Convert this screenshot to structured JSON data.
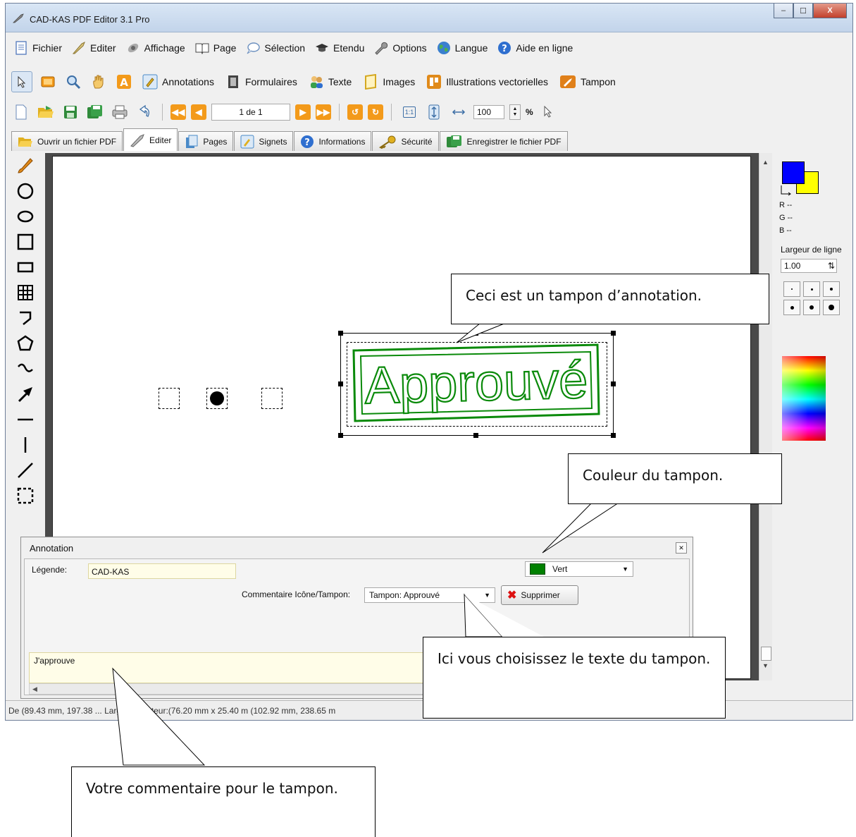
{
  "window": {
    "title": "CAD-KAS PDF Editor 3.1 Pro",
    "controls": {
      "minimize": "–",
      "maximize": "☐",
      "close": "X"
    }
  },
  "menubar": {
    "items": [
      {
        "label": "Fichier",
        "icon": "document-icon",
        "color": "#5b7fbf"
      },
      {
        "label": "Editer",
        "icon": "quill-icon",
        "color": "#b5a04a"
      },
      {
        "label": "Affichage",
        "icon": "satellite-icon",
        "color": "#8a8a8a"
      },
      {
        "label": "Page",
        "icon": "book-icon",
        "color": "#6b6b6b"
      },
      {
        "label": "Sélection",
        "icon": "speech-bubble-icon",
        "color": "#6b8fbf"
      },
      {
        "label": "Etendu",
        "icon": "graduation-cap-icon",
        "color": "#333333"
      },
      {
        "label": "Options",
        "icon": "wrench-icon",
        "color": "#8a8a8a"
      },
      {
        "label": "Langue",
        "icon": "globe-icon",
        "color": "#3a7fcf"
      },
      {
        "label": "Aide en ligne",
        "icon": "help-icon",
        "color": "#2f6fcf"
      }
    ]
  },
  "toolbar2": {
    "labels": [
      {
        "label": "Annotations",
        "icon": "annotation-pen-icon",
        "color": "#4a8ac8"
      },
      {
        "label": "Formulaires",
        "icon": "film-icon",
        "color": "#333333"
      },
      {
        "label": "Texte",
        "icon": "people-icon",
        "color": "#3aa04a"
      },
      {
        "label": "Images",
        "icon": "picture-frame-icon",
        "color": "#d4a820"
      },
      {
        "label": "Illustrations vectorielles",
        "icon": "vector-icon",
        "color": "#e08a1a"
      },
      {
        "label": "Tampon",
        "icon": "stamp-icon",
        "color": "#e0801a"
      }
    ]
  },
  "navigation": {
    "page_indicator": "1 de 1",
    "zoom_value": "100",
    "zoom_unit": "%",
    "fit_label": "1:1"
  },
  "tabs": [
    {
      "label": "Ouvrir un fichier PDF",
      "icon": "open-folder-icon",
      "color": "#e0b020",
      "active": false
    },
    {
      "label": "Editer",
      "icon": "quill-icon",
      "color": "#9a9a9a",
      "active": true
    },
    {
      "label": "Pages",
      "icon": "pages-icon",
      "color": "#4a8ac8",
      "active": false
    },
    {
      "label": "Signets",
      "icon": "bookmark-pen-icon",
      "color": "#4a8ac8",
      "active": false
    },
    {
      "label": "Informations",
      "icon": "help-icon",
      "color": "#2f6fcf",
      "active": false
    },
    {
      "label": "Sécurité",
      "icon": "key-icon",
      "color": "#c9a020",
      "active": false
    },
    {
      "label": "Enregistrer le fichier PDF",
      "icon": "save-icon",
      "color": "#2f8a3a",
      "active": false
    }
  ],
  "stamp": {
    "text": "Approuvé",
    "color": "#0a8a0a"
  },
  "right_panel": {
    "fg_color": "#0000ff",
    "bg_color": "#ffff00",
    "r": "R --",
    "g": "G --",
    "b": "B --",
    "line_width_label": "Largeur de ligne",
    "line_width_value": "1.00"
  },
  "dialog": {
    "title": "Annotation",
    "legend_label": "Légende:",
    "legend_value": "CAD-KAS",
    "color_value": "Vert",
    "color_hex": "#008000",
    "icon_stamp_label": "Commentaire Icône/Tampon:",
    "stamp_value": "Tampon: Approuvé",
    "delete_label": "Supprimer",
    "comment_value": "J'approuve"
  },
  "statusbar": {
    "text": "De (89.43 mm, 197.38 ... Largeur/Hauteur:(76.20 mm x 25.40 m (102.92 mm, 238.65 m"
  },
  "callouts": {
    "annotation_stamp": "Ceci est un tampon d’annotation.",
    "stamp_color": "Couleur du tampon.",
    "stamp_text": "Ici vous choisissez le texte du tampon.",
    "comment": "Votre commentaire pour le tampon."
  }
}
